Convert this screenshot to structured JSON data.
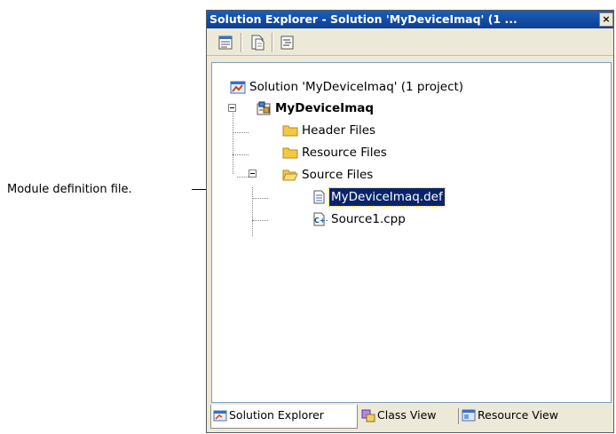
{
  "callout": {
    "text": "Module definition file."
  },
  "window": {
    "title": "Solution Explorer - Solution 'MyDeviceImaq' (1 ...",
    "close_label": "×"
  },
  "toolbar": {
    "buttons": [
      {
        "icon": "properties-icon"
      },
      {
        "icon": "show-all-files-icon"
      },
      {
        "icon": "view-code-icon"
      }
    ]
  },
  "tree": {
    "solution": "Solution 'MyDeviceImaq' (1 project)",
    "project": "MyDeviceImaq",
    "header_files": "Header Files",
    "resource_files": "Resource Files",
    "source_files": "Source Files",
    "def_file": "MyDeviceImaq.def",
    "cpp_file": "Source1.cpp",
    "cpp_badge": "C++"
  },
  "tabs": [
    {
      "label": "Solution Explorer",
      "icon": "solution-explorer-icon",
      "active": true
    },
    {
      "label": "Class View",
      "icon": "class-view-icon",
      "active": false
    },
    {
      "label": "Resource View",
      "icon": "resource-view-icon",
      "active": false
    }
  ]
}
